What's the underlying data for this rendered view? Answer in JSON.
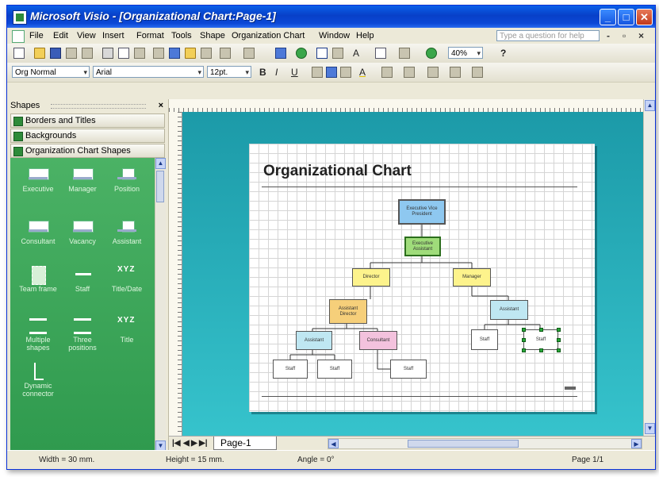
{
  "window": {
    "title": "Microsoft Visio - [Organizational Chart:Page-1]",
    "controls": [
      "minimize",
      "maximize",
      "close"
    ]
  },
  "menu": {
    "items": [
      "File",
      "Edit",
      "View",
      "Insert",
      "Format",
      "Tools",
      "Shape",
      "Organization Chart",
      "Window",
      "Help"
    ],
    "help_placeholder": "Type a question for help"
  },
  "toolbar": {
    "zoom": "40%",
    "style": "Org Normal",
    "font": "Arial",
    "size": "12pt.",
    "bold": "B",
    "italic": "I",
    "underline": "U",
    "text_tool": "A",
    "help_glyph": "?"
  },
  "shapes_pane": {
    "title": "Shapes",
    "close": "×",
    "stencils": [
      "Borders and Titles",
      "Backgrounds",
      "Organization Chart Shapes"
    ],
    "items": [
      {
        "label": "Executive",
        "icon": "box"
      },
      {
        "label": "Manager",
        "icon": "box"
      },
      {
        "label": "Position",
        "icon": "small"
      },
      {
        "label": "Consultant",
        "icon": "box"
      },
      {
        "label": "Vacancy",
        "icon": "box"
      },
      {
        "label": "Assistant",
        "icon": "small"
      },
      {
        "label": "Team frame",
        "icon": "team"
      },
      {
        "label": "Staff",
        "icon": "staff"
      },
      {
        "label": "Title/Date",
        "icon": "xyz"
      },
      {
        "label": "Multiple shapes",
        "icon": "tree"
      },
      {
        "label": "Three positions",
        "icon": "tree"
      },
      {
        "label": "Title",
        "icon": "xyz"
      },
      {
        "label": "Dynamic connector",
        "icon": "conn"
      }
    ]
  },
  "drawing": {
    "title": "Organizational Chart",
    "nodes": [
      {
        "id": "exec",
        "label": "Executive Vice President",
        "color": "#8ec8f0"
      },
      {
        "id": "exec-asst",
        "label": "Executive Assistant",
        "color": "#9fdc7a"
      },
      {
        "id": "director",
        "label": "Director",
        "color": "#fdf38c"
      },
      {
        "id": "manager",
        "label": "Manager",
        "color": "#fdf38c"
      },
      {
        "id": "asst-dir",
        "label": "Assistant Director",
        "color": "#f6cf7a"
      },
      {
        "id": "asst-1",
        "label": "Assistant",
        "color": "#bfe7f2"
      },
      {
        "id": "consultant",
        "label": "Consultant",
        "color": "#f3c2dd"
      },
      {
        "id": "asst-2",
        "label": "Assistant",
        "color": "#bfe7f2"
      },
      {
        "id": "staff-1",
        "label": "Staff",
        "color": "#ffffff"
      },
      {
        "id": "staff-2",
        "label": "Staff",
        "color": "#ffffff"
      },
      {
        "id": "staff-3",
        "label": "Staff",
        "color": "#ffffff"
      },
      {
        "id": "staff-4",
        "label": "Staff",
        "color": "#ffffff"
      },
      {
        "id": "staff-5",
        "label": "Staff",
        "color": "#ffffff"
      }
    ]
  },
  "pages": {
    "nav": [
      "|◀",
      "◀",
      "▶",
      "▶|"
    ],
    "tab": "Page-1"
  },
  "status": {
    "width": "Width = 30 mm.",
    "height": "Height = 15 mm.",
    "angle": "Angle = 0°",
    "page": "Page 1/1"
  }
}
